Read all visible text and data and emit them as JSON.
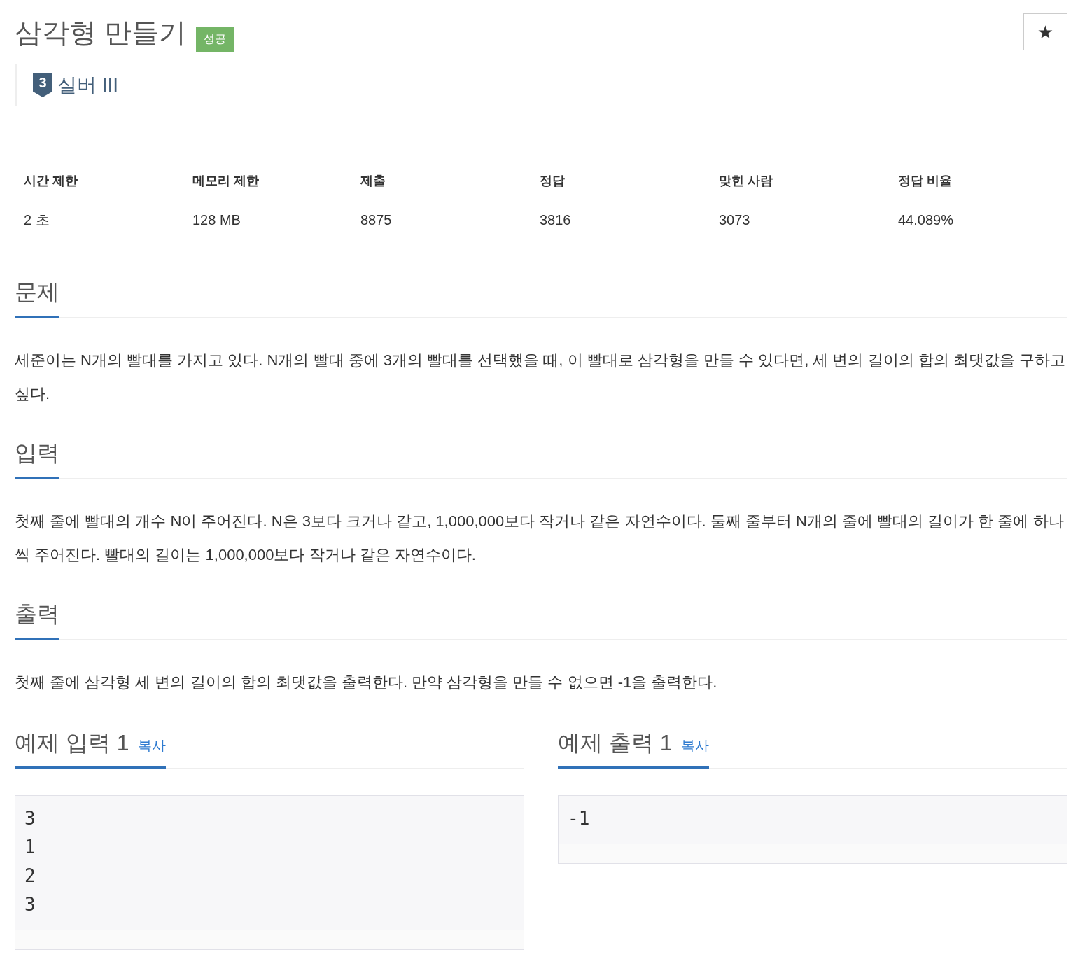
{
  "problem": {
    "title": "삼각형 만들기",
    "result_badge": "성공",
    "star_button": "★"
  },
  "tier": {
    "rank": "3",
    "label": "실버 III"
  },
  "info_table": {
    "columns": [
      "시간 제한",
      "메모리 제한",
      "제출",
      "정답",
      "맞힌 사람",
      "정답 비율"
    ],
    "rows": [
      [
        "2 초",
        "128 MB",
        "8875",
        "3816",
        "3073",
        "44.089%"
      ]
    ]
  },
  "sections": [
    {
      "heading": "문제",
      "text": "세준이는 N개의 빨대를 가지고 있다. N개의 빨대 중에 3개의 빨대를 선택했을 때, 이 빨대로 삼각형을 만들 수 있다면, 세 변의 길이의 합의 최댓값을 구하고 싶다."
    },
    {
      "heading": "입력",
      "text": "첫째 줄에 빨대의 개수 N이 주어진다. N은 3보다 크거나 같고, 1,000,000보다 작거나 같은 자연수이다. 둘째 줄부터 N개의 줄에 빨대의 길이가 한 줄에 하나씩 주어진다. 빨대의 길이는 1,000,000보다 작거나 같은 자연수이다."
    },
    {
      "heading": "출력",
      "text": "첫째 줄에 삼각형 세 변의 길이의 합의 최댓값을 출력한다. 만약 삼각형을 만들 수 없으면 -1을 출력한다."
    }
  ],
  "samples": [
    {
      "heading": "예제 입력 1",
      "copy_label": "복사",
      "content": "3\n1\n2\n3"
    },
    {
      "heading": "예제 출력 1",
      "copy_label": "복사",
      "content": "-1"
    }
  ]
}
